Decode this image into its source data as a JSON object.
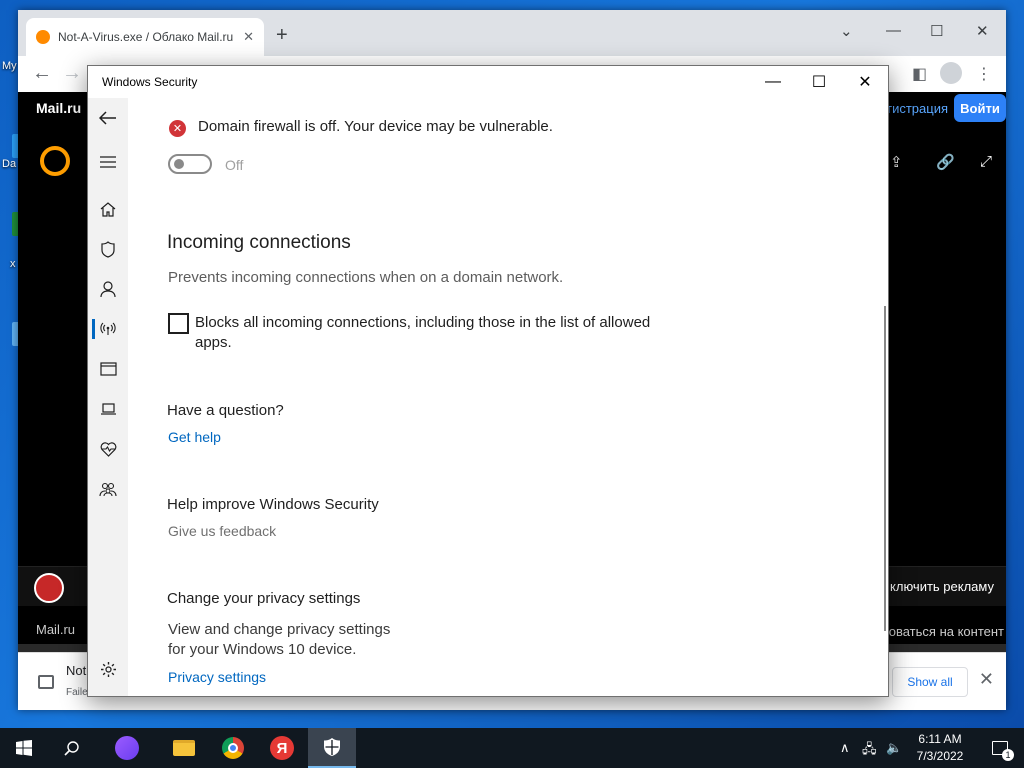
{
  "browser": {
    "tab_title": "Not-A-Virus.exe / Облако Mail.ru",
    "tab_close": "✕",
    "new_tab": "+",
    "mail_logo": "Mail.ru",
    "registration": "гистрация",
    "login": "Войти",
    "ad_right": "ключить рекламу",
    "footer_left": "Mail.ru",
    "footer_right": "оваться на контент"
  },
  "download": {
    "name": "Not",
    "status": "Faile",
    "show_all": "Show all",
    "close": "✕"
  },
  "security": {
    "window_title": "Windows Security",
    "status_message": "Domain firewall is off. Your device may be vulnerable.",
    "toggle_label": "Off",
    "incoming_title": "Incoming connections",
    "incoming_desc": "Prevents incoming connections when on a domain network.",
    "checkbox_label": "Blocks all incoming connections, including those in the list of allowed apps.",
    "question_title": "Have a question?",
    "get_help": "Get help",
    "improve_title": "Help improve Windows Security",
    "feedback": "Give us feedback",
    "privacy_title": "Change your privacy settings",
    "privacy_desc": "View and change privacy settings for your Windows 10 device.",
    "privacy_link": "Privacy settings",
    "nav_icons": [
      "back-arrow-icon",
      "hamburger-menu-icon",
      "home-icon",
      "shield-icon",
      "account-icon",
      "firewall-network-icon",
      "app-browser-icon",
      "device-laptop-icon",
      "device-health-icon",
      "family-icon",
      "settings-gear-icon"
    ],
    "accent": "#0067c0",
    "error_color": "#d13438"
  },
  "taskbar": {
    "time": "6:11 AM",
    "date": "7/3/2022",
    "notification_count": "1"
  },
  "desktop": {
    "label_1": "My",
    "label_2": "Da",
    "label_3": "x"
  }
}
